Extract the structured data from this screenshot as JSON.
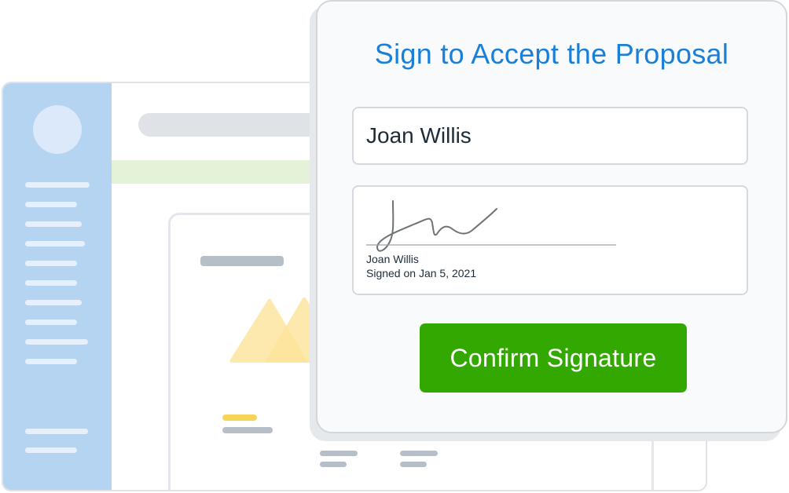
{
  "dialog": {
    "title": "Sign to Accept the Proposal",
    "name_value": "Joan Willis",
    "signature": {
      "signer_name": "Joan Willis",
      "signed_on": "Signed on Jan 5, 2021"
    },
    "confirm_label": "Confirm Signature"
  },
  "colors": {
    "title": "#1a7fd6",
    "confirm_button": "#33a800",
    "sidebar": "#b5d4f2",
    "placeholder_triangles": "#fde49a"
  }
}
